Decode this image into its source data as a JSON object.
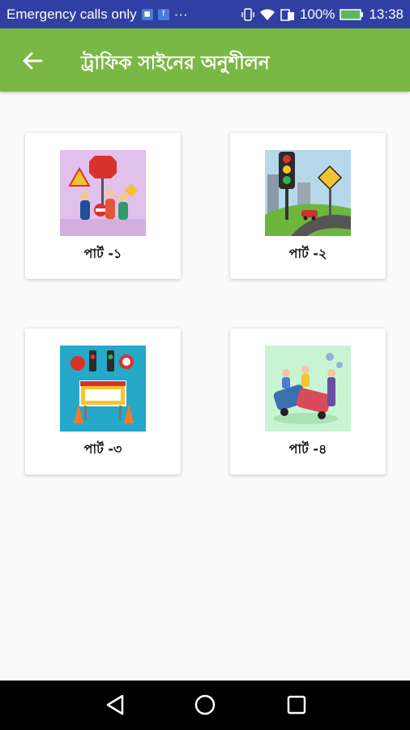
{
  "status_bar": {
    "carrier_text": "Emergency calls only",
    "battery": "100%",
    "time": "13:38"
  },
  "app_bar": {
    "title": "ট্রাফিক সাইনের অনুশীলন",
    "back_icon": "arrow-back-icon"
  },
  "cards": [
    {
      "label": "পার্ট -১"
    },
    {
      "label": "পার্ট -২"
    },
    {
      "label": "পার্ট -৩"
    },
    {
      "label": "পার্ট -৪"
    }
  ],
  "nav_bar": {
    "buttons": [
      "back-triangle-icon",
      "home-circle-icon",
      "recents-square-icon"
    ]
  },
  "colors": {
    "status_bar": "#2f3fa2",
    "app_bar": "#79b844",
    "background": "#fafafa"
  }
}
